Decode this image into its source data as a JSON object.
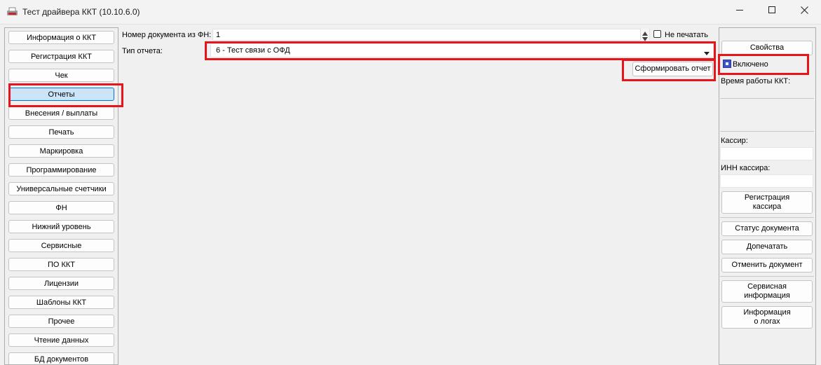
{
  "window": {
    "title": "Тест драйвера ККТ (10.10.6.0)",
    "icons": {
      "app": "printer-icon",
      "minimize": "minimize-icon",
      "maximize": "maximize-icon",
      "close": "close-icon"
    }
  },
  "nav": {
    "items": [
      "Информация о ККТ",
      "Регистрация ККТ",
      "Чек",
      "Отчеты",
      "Внесения / выплаты",
      "Печать",
      "Маркировка",
      "Программирование",
      "Универсальные счетчики",
      "ФН",
      "Нижний уровень",
      "Сервисные",
      "ПО ККТ",
      "Лицензии",
      "Шаблоны ККТ",
      "Прочее",
      "Чтение данных",
      "БД документов"
    ],
    "active": "Отчеты"
  },
  "report": {
    "doc_number_label": "Номер документа из ФН:",
    "doc_number_value": "1",
    "no_print_label": "Не печатать",
    "no_print_checked": false,
    "type_label": "Тип отчета:",
    "type_value": "6 - Тест связи с ОФД",
    "generate_button": "Сформировать отчет"
  },
  "side": {
    "properties_button": "Свойства",
    "enabled_label": "Включено",
    "enabled_checked": true,
    "uptime_label": "Время работы ККТ:",
    "cashier_label": "Кассир:",
    "cashier_value": "",
    "cashier_inn_label": "ИНН кассира:",
    "cashier_inn_value": "",
    "register_cashier_button": "Регистрация\nкассира",
    "doc_status_button": "Статус документа",
    "reprint_button": "Допечатать",
    "cancel_doc_button": "Отменить документ",
    "service_info_button": "Сервисная\nинформация",
    "logs_info_button": "Информация\nо логах"
  },
  "colors": {
    "highlight": "#e8141b",
    "active_nav": "#cce4f7",
    "active_nav_border": "#0078d7",
    "checkbox_checked": "#3b4fd1"
  }
}
